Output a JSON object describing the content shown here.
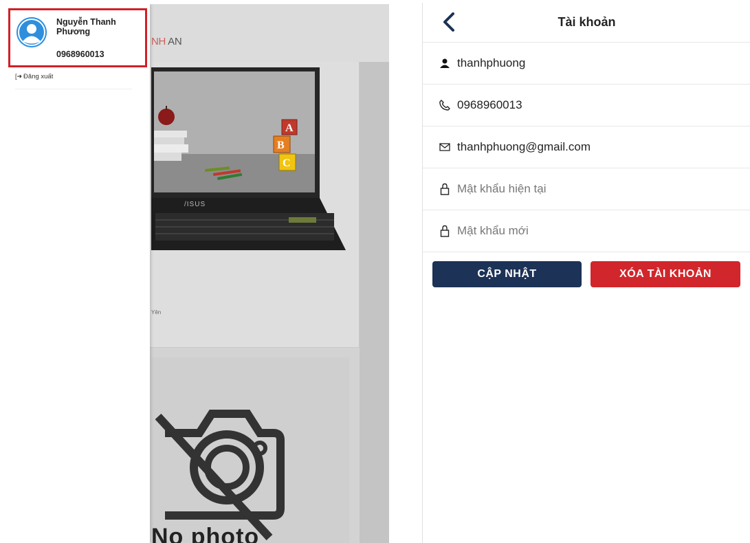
{
  "left_screen": {
    "drawer": {
      "profile": {
        "name": "Nguyễn Thanh Phương",
        "phone": "0968960013"
      },
      "logout_label": "Đăng xuất"
    },
    "background": {
      "header_title_part1": "NH",
      "header_title_part2": " AN",
      "product_snippet": "Yên",
      "nophoto_text": "No photo"
    }
  },
  "account_screen": {
    "title": "Tài khoản",
    "username": "thanhphuong",
    "phone": "0968960013",
    "email": "thanhphuong@gmail.com",
    "current_password_placeholder": "Mật khẩu hiện tại",
    "new_password_placeholder": "Mật khẩu mới",
    "update_button": "CẬP NHẬT",
    "delete_button": "XÓA TÀI KHOẢN"
  },
  "colors": {
    "accent_red": "#d21f26",
    "primary_navy": "#1c3256",
    "avatar_blue": "#2f8fdd"
  },
  "icons": {
    "avatar": "user-avatar-icon",
    "logout": "logout-icon",
    "back": "chevron-left-icon",
    "user": "user-icon",
    "phone": "phone-icon",
    "email": "envelope-icon",
    "lock": "lock-icon",
    "camera_slash": "camera-off-icon"
  }
}
